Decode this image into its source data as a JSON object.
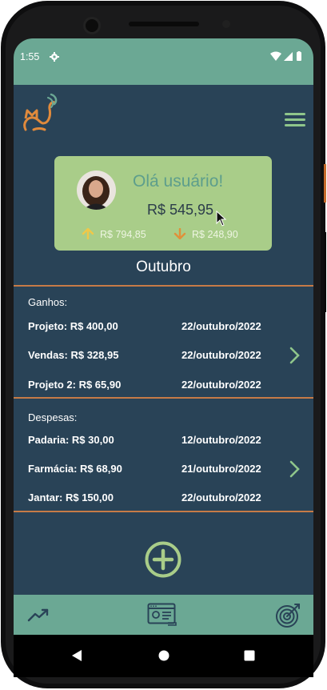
{
  "status_bar": {
    "time": "1:55",
    "icons": [
      "gear-icon",
      "wifi-icon",
      "signal-icon",
      "battery-icon"
    ]
  },
  "header": {
    "logo": "cat-logo",
    "menu_icon": "hamburger-menu-icon"
  },
  "summary_card": {
    "greeting": "Olá usuário!",
    "balance": "R$ 545,95",
    "income": "R$ 794,85",
    "expense": "R$ 248,90",
    "income_icon": "arrow-up-icon",
    "expense_icon": "arrow-down-icon"
  },
  "month": "Outubro",
  "gains": {
    "label": "Ganhos:",
    "items": [
      {
        "description": "Projeto: R$ 400,00",
        "date": "22/outubro/2022"
      },
      {
        "description": "Vendas: R$ 328,95",
        "date": "22/outubro/2022"
      },
      {
        "description": "Projeto 2: R$ 65,90",
        "date": "22/outubro/2022"
      }
    ]
  },
  "expenses": {
    "label": "Despesas:",
    "items": [
      {
        "description": "Padaria: R$ 30,00",
        "date": "12/outubro/2022"
      },
      {
        "description": "Farmácia: R$ 68,90",
        "date": "21/outubro/2022"
      },
      {
        "description": "Jantar: R$ 150,00",
        "date": "22/outubro/2022"
      }
    ]
  },
  "bottom_nav": [
    "trend-chart-icon",
    "profile-card-icon",
    "target-icon"
  ],
  "colors": {
    "status_bar": "#6ba894",
    "background": "#294357",
    "card": "#a9cd89",
    "greeting": "#5d9e8c",
    "divider": "#c67b47",
    "accent_green": "#8fc68b",
    "income_arrow": "#f0c848",
    "expense_arrow": "#e0903a"
  }
}
